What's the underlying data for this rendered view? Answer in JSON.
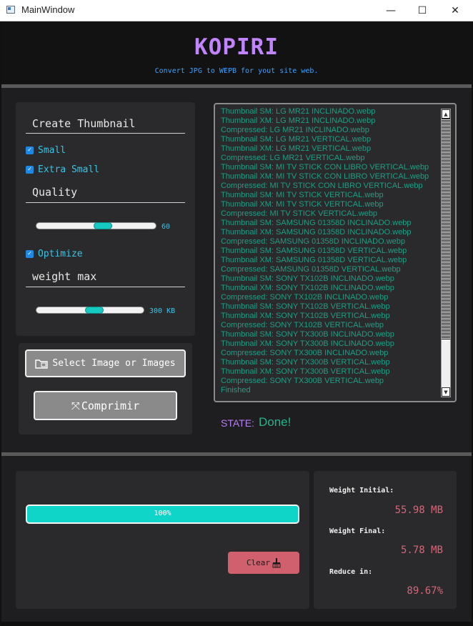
{
  "window": {
    "title": "MainWindow",
    "minimize": "—",
    "maximize": "☐",
    "close": "✕"
  },
  "header": {
    "title": "KOPIRI",
    "subtitle": "Convert JPG to WEPB for yout site web."
  },
  "settings": {
    "thumbnail_title": "Create Thumbnail",
    "small_label": "Small",
    "small_checked": true,
    "extra_small_label": "Extra Small",
    "extra_small_checked": true,
    "quality_title": "Quality",
    "quality_value": "60",
    "quality_level": 0.57,
    "optimize_label": "Optimize",
    "optimize_checked": true,
    "weight_title": "weight max",
    "weight_value": "300 KB",
    "weight_level": 0.55
  },
  "actions": {
    "select_label": "Select Image or Images",
    "compress_label": "Comprimir"
  },
  "log": [
    "Thumbnail SM: LG MR21 INCLINADO.webp",
    "Thumbnail XM: LG MR21 INCLINADO.webp",
    "Compressed: LG MR21 INCLINADO.webp",
    "Thumbnail SM: LG MR21 VERTICAL.webp",
    "Thumbnail XM: LG MR21 VERTICAL.webp",
    "Compressed: LG MR21 VERTICAL.webp",
    "Thumbnail SM: MI TV STICK CON LIBRO VERTICAL.webp",
    "Thumbnail XM: MI TV STICK CON LIBRO VERTICAL.webp",
    "Compressed: MI TV STICK CON LIBRO VERTICAL.webp",
    "Thumbnail SM: MI TV STICK VERTICAL.webp",
    "Thumbnail XM: MI TV STICK VERTICAL.webp",
    "Compressed: MI TV STICK VERTICAL.webp",
    "Thumbnail SM: SAMSUNG 01358D INCLINADO.webp",
    "Thumbnail XM: SAMSUNG 01358D INCLINADO.webp",
    "Compressed: SAMSUNG 01358D INCLINADO.webp",
    "Thumbnail SM: SAMSUNG 01358D VERTICAL.webp",
    "Thumbnail XM: SAMSUNG 01358D VERTICAL.webp",
    "Compressed: SAMSUNG 01358D VERTICAL.webp",
    "Thumbnail SM: SONY TX102B INCLINADO.webp",
    "Thumbnail XM: SONY TX102B INCLINADO.webp",
    "Compressed: SONY TX102B INCLINADO.webp",
    "Thumbnail SM: SONY TX102B VERTICAL.webp",
    "Thumbnail XM: SONY TX102B VERTICAL.webp",
    "Compressed: SONY TX102B VERTICAL.webp",
    "Thumbnail SM: SONY TX300B INCLINADO.webp",
    "Thumbnail XM: SONY TX300B INCLINADO.webp",
    "Compressed: SONY TX300B INCLINADO.webp",
    "Thumbnail SM: SONY TX300B VERTICAL.webp",
    "Thumbnail XM: SONY TX300B VERTICAL.webp",
    "Compressed: SONY TX300B VERTICAL.webp",
    "Finished"
  ],
  "status": {
    "label": "STATE:",
    "value": "Done!"
  },
  "progress": {
    "percent": 100,
    "text": "100%"
  },
  "clear": {
    "label": "Clear"
  },
  "stats": {
    "initial_label": "Weight Initial:",
    "initial_value": "55.98 MB",
    "final_label": "Weight Final:",
    "final_value": "5.78 MB",
    "reduce_label": "Reduce in:",
    "reduce_value": "89.67%"
  },
  "colors": {
    "accent_title": "#c084fc",
    "subtitle": "#3aa3ff",
    "log_text": "#1f9e86",
    "teal": "#0fd4c8",
    "clear_button": "#d1606e"
  }
}
